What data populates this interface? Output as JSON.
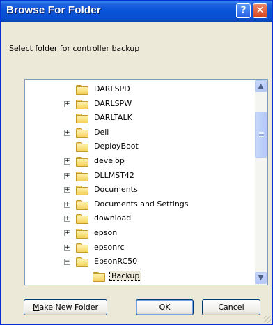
{
  "window": {
    "title": "Browse For Folder",
    "help_glyph": "?",
    "close_glyph": "✕"
  },
  "prompt": "Select folder for controller backup",
  "tree": {
    "items": [
      {
        "label": "DARLSPD",
        "expander": "",
        "indent": 1
      },
      {
        "label": "DARLSPW",
        "expander": "+",
        "indent": 1
      },
      {
        "label": "DARLTALK",
        "expander": "",
        "indent": 1
      },
      {
        "label": "Dell",
        "expander": "+",
        "indent": 1
      },
      {
        "label": "DeployBoot",
        "expander": "",
        "indent": 1
      },
      {
        "label": "develop",
        "expander": "+",
        "indent": 1
      },
      {
        "label": "DLLMST42",
        "expander": "+",
        "indent": 1
      },
      {
        "label": "Documents",
        "expander": "+",
        "indent": 1
      },
      {
        "label": "Documents and Settings",
        "expander": "+",
        "indent": 1
      },
      {
        "label": "download",
        "expander": "+",
        "indent": 1
      },
      {
        "label": "epson",
        "expander": "+",
        "indent": 1
      },
      {
        "label": "epsonrc",
        "expander": "+",
        "indent": 1
      },
      {
        "label": "EpsonRC50",
        "expander": "−",
        "indent": 1
      },
      {
        "label": "Backup",
        "expander": "",
        "indent": 2,
        "selected": true
      }
    ],
    "scroll_up_glyph": "▲",
    "scroll_down_glyph": "▼"
  },
  "buttons": {
    "new_folder_mnemonic": "M",
    "new_folder_rest": "ake New Folder",
    "ok": "OK",
    "cancel": "Cancel"
  }
}
